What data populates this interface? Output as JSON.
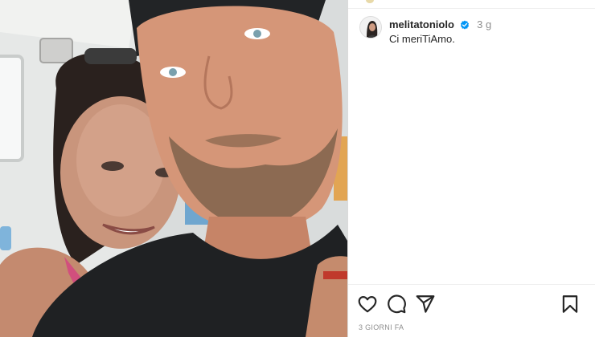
{
  "post": {
    "username": "melitatoniolo",
    "verified": true,
    "time_ago": "3 g",
    "caption": "Ci meriTiAmo.",
    "date_label": "3 GIORNI FA"
  },
  "icons": {
    "like": "heart-icon",
    "comment": "comment-bubble-icon",
    "share": "paper-plane-icon",
    "save": "bookmark-icon",
    "verified": "verified-badge-icon"
  },
  "colors": {
    "verified_blue": "#0095f6",
    "text_primary": "#262626",
    "text_secondary": "#8e8e8e",
    "divider": "#efefef"
  }
}
